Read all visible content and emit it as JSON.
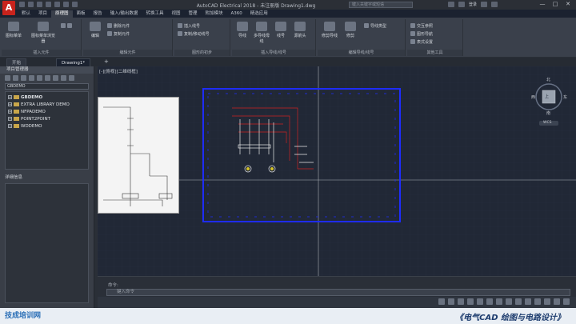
{
  "titlebar": {
    "app_logo": "A",
    "title": "AutoCAD Electrical 2018 - 未注册版    Drawing1.dwg",
    "search_placeholder": "键入关键字或短语",
    "user": "登录"
  },
  "ribbon": {
    "tabs": [
      "默认",
      "项目",
      "原理图",
      "面板",
      "报告",
      "输入/输出数据",
      "转换工具",
      "视图",
      "管理",
      "附加模块",
      "A360",
      "精选应用"
    ],
    "active_tab": "原理图",
    "groups": [
      {
        "label": "插入元件",
        "buttons": [
          "图标菜单",
          "图标菜单浏览器"
        ]
      },
      {
        "label": "编辑元件",
        "buttons": [
          "编辑",
          "删除元件",
          "复制元件"
        ]
      },
      {
        "label": "图形的初步",
        "buttons": [
          "插入线号",
          "复制/移动线号"
        ]
      },
      {
        "label": "插入导线/线号",
        "buttons": [
          "导线",
          "多导线母线",
          "线号",
          "源箭头"
        ]
      },
      {
        "label": "编辑导线/线号",
        "buttons": [
          "修剪导线",
          "修剪",
          "导线类型"
        ]
      },
      {
        "label": "其他工具",
        "buttons": [
          "交互参照",
          "图形导航",
          "表式设置"
        ]
      }
    ]
  },
  "doc_tabs": [
    "开始",
    "Drawing1*"
  ],
  "project_manager": {
    "title": "项目管理器",
    "selected": "GBDEMO",
    "projects": [
      "GBDEMO",
      "EXTRA LIBRARY DEMO",
      "NFPADEMO",
      "POINT2POINT",
      "WDDEMO"
    ],
    "details_label": "详细信息"
  },
  "canvas": {
    "viewport_label": "[-][俯视][二维线框]",
    "navcube": {
      "north": "北",
      "south": "南",
      "east": "东",
      "west": "西",
      "center": "上",
      "wcs": "WCS"
    }
  },
  "command": {
    "history": "命令:",
    "input_placeholder": "键入命令"
  },
  "footer": {
    "brand": "技成培训网",
    "course_title": "《电气CAD 绘图与电路设计》"
  },
  "colors": {
    "canvas_bg": "#212836",
    "frame": "#1e2cff",
    "wire_red": "#cc2222",
    "accent_logo": "#c8231c"
  }
}
